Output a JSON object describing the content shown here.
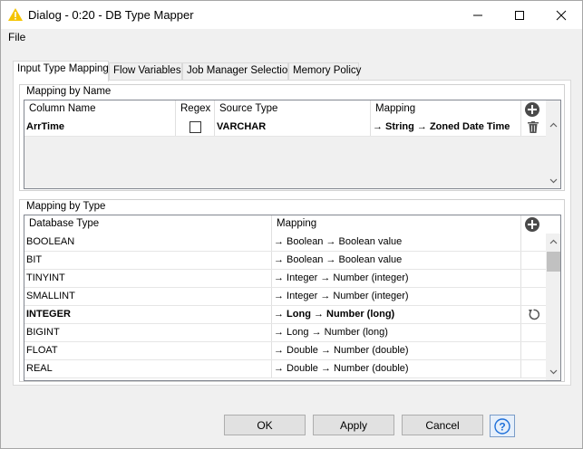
{
  "window": {
    "title": "Dialog - 0:20 - DB Type Mapper",
    "accent_color": "#f5c400"
  },
  "menu": {
    "file": "File"
  },
  "tabs": [
    {
      "label": "Input Type Mapping"
    },
    {
      "label": "Flow Variables"
    },
    {
      "label": "Job Manager Selection"
    },
    {
      "label": "Memory Policy"
    }
  ],
  "by_name": {
    "group_label": "Mapping by Name",
    "headers": {
      "column_name": "Column Name",
      "regex": "Regex",
      "source_type": "Source Type",
      "mapping": "Mapping"
    },
    "rows": [
      {
        "column_name": "ArrTime",
        "regex": false,
        "source_type": "VARCHAR",
        "mapping": "→ String → Zoned Date Time"
      }
    ]
  },
  "by_type": {
    "group_label": "Mapping by Type",
    "headers": {
      "database_type": "Database Type",
      "mapping": "Mapping"
    },
    "rows": [
      {
        "database_type": "BOOLEAN",
        "mapping": "→ Boolean → Boolean value"
      },
      {
        "database_type": "BIT",
        "mapping": "→ Boolean → Boolean value"
      },
      {
        "database_type": "TINYINT",
        "mapping": "→ Integer → Number (integer)"
      },
      {
        "database_type": "SMALLINT",
        "mapping": "→ Integer → Number (integer)"
      },
      {
        "database_type": "INTEGER",
        "mapping": "→ Long → Number (long)"
      },
      {
        "database_type": "BIGINT",
        "mapping": "→ Long → Number (long)"
      },
      {
        "database_type": "FLOAT",
        "mapping": "→ Double → Number (double)"
      },
      {
        "database_type": "REAL",
        "mapping": "→ Double → Number (double)"
      }
    ]
  },
  "buttons": {
    "ok": "OK",
    "apply": "Apply",
    "cancel": "Cancel"
  }
}
